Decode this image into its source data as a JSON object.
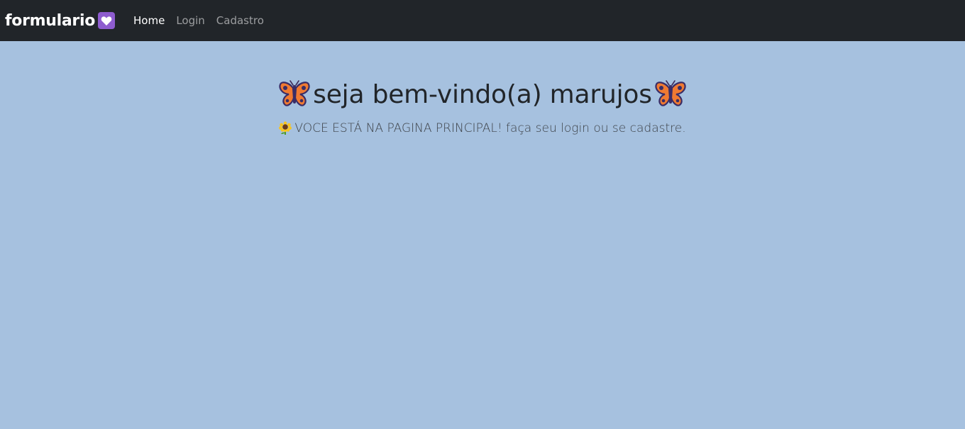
{
  "navbar": {
    "brand": "formulario",
    "brand_icon": "heart-icon",
    "links": [
      {
        "label": "Home",
        "active": true
      },
      {
        "label": "Login",
        "active": false
      },
      {
        "label": "Cadastro",
        "active": false
      }
    ]
  },
  "hero": {
    "title": "seja bem-vindo(a) marujos",
    "title_icon": "butterfly-icon",
    "subtitle": "VOCE ESTÁ NA PAGINA PRINCIPAL! faça seu login ou se cadastre.",
    "subtitle_icon": "sunflower-icon"
  },
  "colors": {
    "navbar_bg": "#212529",
    "page_bg": "#a6c1df",
    "heart_bg": "#8e5ccf"
  }
}
